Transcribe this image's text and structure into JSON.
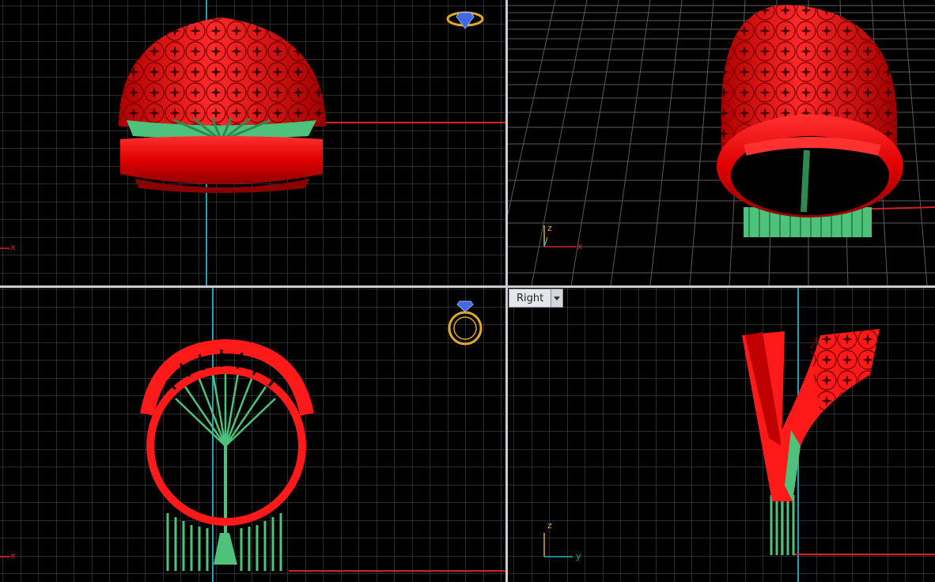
{
  "viewports": {
    "top": {
      "x_axis": "x",
      "axis_color": "#ff2020"
    },
    "perspective": {
      "axis_z": "z",
      "axis_x": "x"
    },
    "front": {
      "x_axis": "x"
    },
    "right": {
      "tab_label": "Right",
      "axis_z": "z",
      "axis_y": "y"
    }
  },
  "colors": {
    "background": "#000000",
    "grid_minor": "#555555",
    "grid_major": "#7a7a7a",
    "model_red": "#ff0c0c",
    "support_green": "#4ec27a",
    "axis_red": "#d42222",
    "axis_cyan": "#1aa5b3",
    "widget_gold": "#e0a92c"
  },
  "icons": [
    "ring-navigation-widget-icon",
    "dropdown-arrow-icon"
  ]
}
